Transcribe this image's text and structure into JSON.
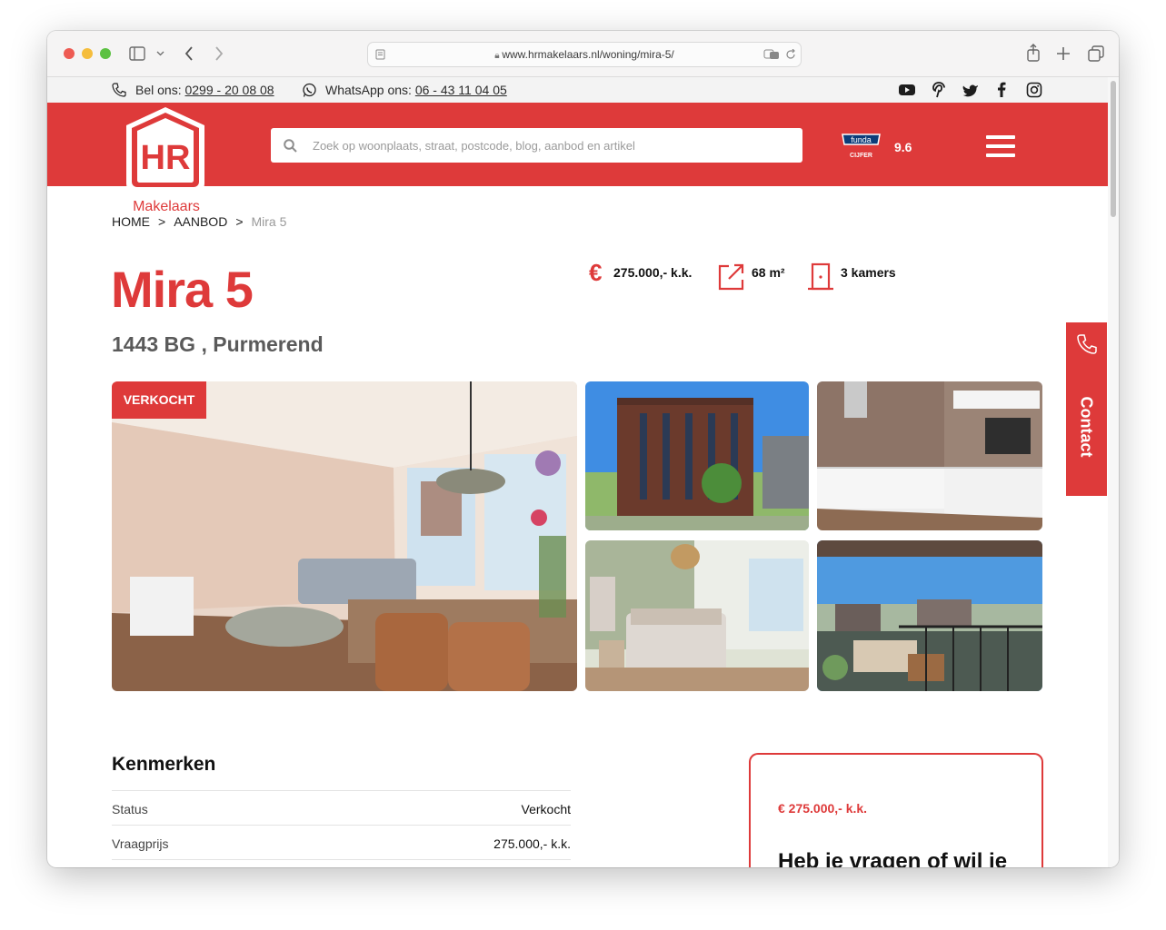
{
  "browser": {
    "url": "www.hrmakelaars.nl/woning/mira-5/"
  },
  "topbar": {
    "phone_prefix": "Bel ons:",
    "phone": "0299 - 20 08 08",
    "whatsapp_prefix": "WhatsApp ons:",
    "whatsapp": "06 - 43 11 04 05",
    "social": [
      "youtube-icon",
      "pinterest-icon",
      "twitter-icon",
      "facebook-icon",
      "instagram-icon"
    ]
  },
  "header": {
    "logo_letters": "HR",
    "logo_text": "Makelaars",
    "search_placeholder": "Zoek op woonplaats, straat, postcode, blog, aanbod en artikel",
    "funda_label": "funda",
    "funda_sub": "CIJFER",
    "funda_score": "9.6",
    "brand_color": "#de3a3a"
  },
  "breadcrumb": {
    "items": [
      "HOME",
      "AANBOD",
      "Mira 5"
    ],
    "separator": ">"
  },
  "property": {
    "title": "Mira 5",
    "address": "1443 BG , Purmerend",
    "price": "275.000,- k.k.",
    "area": "68 m²",
    "rooms": "3 kamers",
    "badge": "VERKOCHT"
  },
  "contact_tab": {
    "label": "Contact"
  },
  "kenmerken": {
    "title": "Kenmerken",
    "rows": [
      {
        "label": "Status",
        "value": "Verkocht"
      },
      {
        "label": "Vraagprijs",
        "value": "275.000,- k.k."
      }
    ]
  },
  "sidebox": {
    "price": "€ 275.000,- k.k.",
    "heading": "Heb je vragen of wil je"
  }
}
